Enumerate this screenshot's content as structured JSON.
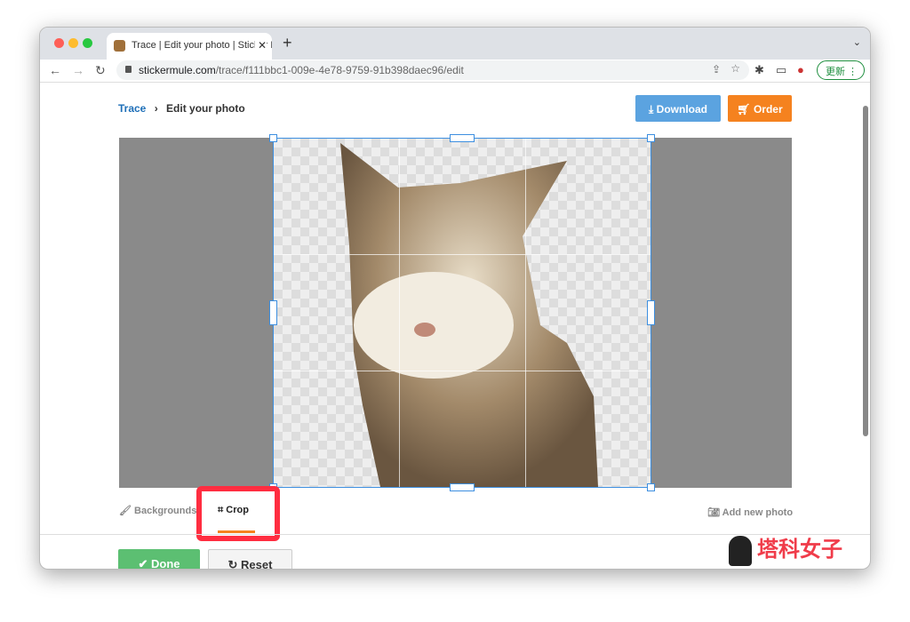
{
  "browser": {
    "tab_title": "Trace | Edit your photo | Sticker Mule",
    "url_domain": "stickermule.com",
    "url_path": "/trace/f111bbc1-009e-4e78-9759-91b398daec96/edit",
    "update_label": "更新"
  },
  "page": {
    "breadcrumb": {
      "parent": "Trace",
      "current": "Edit your photo"
    },
    "download_label": "Download",
    "order_label": "Order",
    "tools": {
      "backgrounds": "Backgrounds",
      "crop": "Crop",
      "add_photo": "Add new photo"
    },
    "done_label": "Done",
    "reset_label": "Reset"
  },
  "colors": {
    "download": "#5ba3e0",
    "order": "#f5821f",
    "done": "#5cbf72",
    "crop_border": "#3d8fe0",
    "highlight": "#ff2d40"
  },
  "watermark": "塔科女子"
}
